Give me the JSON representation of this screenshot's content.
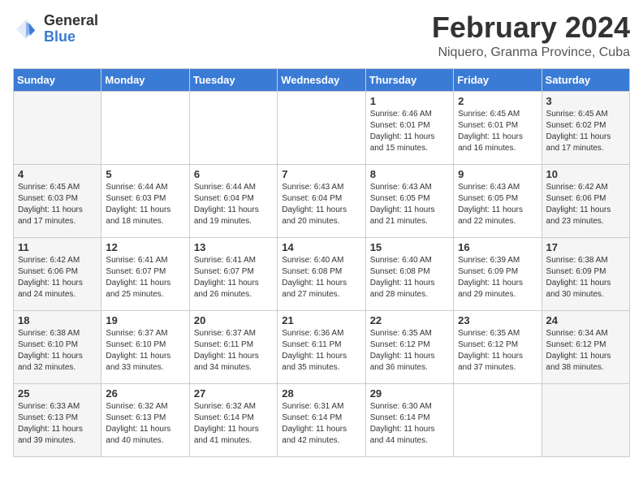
{
  "logo": {
    "general": "General",
    "blue": "Blue"
  },
  "title": "February 2024",
  "subtitle": "Niquero, Granma Province, Cuba",
  "days_of_week": [
    "Sunday",
    "Monday",
    "Tuesday",
    "Wednesday",
    "Thursday",
    "Friday",
    "Saturday"
  ],
  "weeks": [
    [
      {
        "day": "",
        "info": ""
      },
      {
        "day": "",
        "info": ""
      },
      {
        "day": "",
        "info": ""
      },
      {
        "day": "",
        "info": ""
      },
      {
        "day": "1",
        "info": "Sunrise: 6:46 AM\nSunset: 6:01 PM\nDaylight: 11 hours and 15 minutes."
      },
      {
        "day": "2",
        "info": "Sunrise: 6:45 AM\nSunset: 6:01 PM\nDaylight: 11 hours and 16 minutes."
      },
      {
        "day": "3",
        "info": "Sunrise: 6:45 AM\nSunset: 6:02 PM\nDaylight: 11 hours and 17 minutes."
      }
    ],
    [
      {
        "day": "4",
        "info": "Sunrise: 6:45 AM\nSunset: 6:03 PM\nDaylight: 11 hours and 17 minutes."
      },
      {
        "day": "5",
        "info": "Sunrise: 6:44 AM\nSunset: 6:03 PM\nDaylight: 11 hours and 18 minutes."
      },
      {
        "day": "6",
        "info": "Sunrise: 6:44 AM\nSunset: 6:04 PM\nDaylight: 11 hours and 19 minutes."
      },
      {
        "day": "7",
        "info": "Sunrise: 6:43 AM\nSunset: 6:04 PM\nDaylight: 11 hours and 20 minutes."
      },
      {
        "day": "8",
        "info": "Sunrise: 6:43 AM\nSunset: 6:05 PM\nDaylight: 11 hours and 21 minutes."
      },
      {
        "day": "9",
        "info": "Sunrise: 6:43 AM\nSunset: 6:05 PM\nDaylight: 11 hours and 22 minutes."
      },
      {
        "day": "10",
        "info": "Sunrise: 6:42 AM\nSunset: 6:06 PM\nDaylight: 11 hours and 23 minutes."
      }
    ],
    [
      {
        "day": "11",
        "info": "Sunrise: 6:42 AM\nSunset: 6:06 PM\nDaylight: 11 hours and 24 minutes."
      },
      {
        "day": "12",
        "info": "Sunrise: 6:41 AM\nSunset: 6:07 PM\nDaylight: 11 hours and 25 minutes."
      },
      {
        "day": "13",
        "info": "Sunrise: 6:41 AM\nSunset: 6:07 PM\nDaylight: 11 hours and 26 minutes."
      },
      {
        "day": "14",
        "info": "Sunrise: 6:40 AM\nSunset: 6:08 PM\nDaylight: 11 hours and 27 minutes."
      },
      {
        "day": "15",
        "info": "Sunrise: 6:40 AM\nSunset: 6:08 PM\nDaylight: 11 hours and 28 minutes."
      },
      {
        "day": "16",
        "info": "Sunrise: 6:39 AM\nSunset: 6:09 PM\nDaylight: 11 hours and 29 minutes."
      },
      {
        "day": "17",
        "info": "Sunrise: 6:38 AM\nSunset: 6:09 PM\nDaylight: 11 hours and 30 minutes."
      }
    ],
    [
      {
        "day": "18",
        "info": "Sunrise: 6:38 AM\nSunset: 6:10 PM\nDaylight: 11 hours and 32 minutes."
      },
      {
        "day": "19",
        "info": "Sunrise: 6:37 AM\nSunset: 6:10 PM\nDaylight: 11 hours and 33 minutes."
      },
      {
        "day": "20",
        "info": "Sunrise: 6:37 AM\nSunset: 6:11 PM\nDaylight: 11 hours and 34 minutes."
      },
      {
        "day": "21",
        "info": "Sunrise: 6:36 AM\nSunset: 6:11 PM\nDaylight: 11 hours and 35 minutes."
      },
      {
        "day": "22",
        "info": "Sunrise: 6:35 AM\nSunset: 6:12 PM\nDaylight: 11 hours and 36 minutes."
      },
      {
        "day": "23",
        "info": "Sunrise: 6:35 AM\nSunset: 6:12 PM\nDaylight: 11 hours and 37 minutes."
      },
      {
        "day": "24",
        "info": "Sunrise: 6:34 AM\nSunset: 6:12 PM\nDaylight: 11 hours and 38 minutes."
      }
    ],
    [
      {
        "day": "25",
        "info": "Sunrise: 6:33 AM\nSunset: 6:13 PM\nDaylight: 11 hours and 39 minutes."
      },
      {
        "day": "26",
        "info": "Sunrise: 6:32 AM\nSunset: 6:13 PM\nDaylight: 11 hours and 40 minutes."
      },
      {
        "day": "27",
        "info": "Sunrise: 6:32 AM\nSunset: 6:14 PM\nDaylight: 11 hours and 41 minutes."
      },
      {
        "day": "28",
        "info": "Sunrise: 6:31 AM\nSunset: 6:14 PM\nDaylight: 11 hours and 42 minutes."
      },
      {
        "day": "29",
        "info": "Sunrise: 6:30 AM\nSunset: 6:14 PM\nDaylight: 11 hours and 44 minutes."
      },
      {
        "day": "",
        "info": ""
      },
      {
        "day": "",
        "info": ""
      }
    ]
  ]
}
